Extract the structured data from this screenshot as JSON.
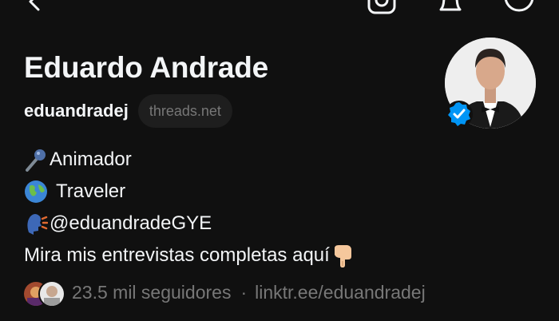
{
  "profile": {
    "name": "Eduardo Andrade",
    "username": "eduandradej",
    "domain": "threads.net",
    "verified": true
  },
  "bio": {
    "line1": "Animador",
    "line2": "Traveler",
    "line3": "@eduandradeGYE",
    "line4": "Mira mis entrevistas completas aquí"
  },
  "meta": {
    "followers": "23.5 mil seguidores",
    "separator": "·",
    "link": "linktr.ee/eduandradej"
  },
  "icons": {
    "back": "back-arrow-icon",
    "instagram": "instagram-icon",
    "notifications": "bell-icon",
    "menu": "menu-icon",
    "verified": "verified-badge-icon"
  },
  "colors": {
    "background": "#101010",
    "text": "#f3f5f7",
    "muted": "#777777",
    "verified": "#0095f6"
  }
}
